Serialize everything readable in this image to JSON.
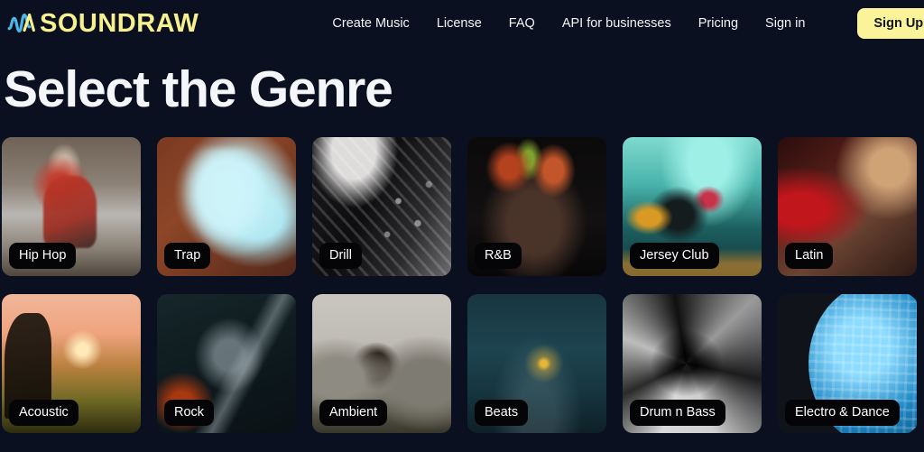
{
  "header": {
    "brand": {
      "wordmark": "SOUNDRAW",
      "logo_icon": "waveform-icon",
      "logo_color": "#4db8e8",
      "wordmark_color": "#f6f08f"
    },
    "nav_links": [
      {
        "label": "Create Music",
        "name": "nav-create-music"
      },
      {
        "label": "License",
        "name": "nav-license"
      },
      {
        "label": "FAQ",
        "name": "nav-faq"
      },
      {
        "label": "API for businesses",
        "name": "nav-api-for-businesses"
      },
      {
        "label": "Pricing",
        "name": "nav-pricing"
      },
      {
        "label": "Sign in",
        "name": "nav-sign-in"
      }
    ],
    "signup_label": "Sign Up",
    "signup_bg": "#faf39a",
    "signup_text_color": "#111722"
  },
  "page": {
    "title": "Select the Genre",
    "background": "#0a1020",
    "title_color": "#f4f6fa"
  },
  "genres": [
    {
      "label": "Hip Hop",
      "art": "art-hiphop",
      "name": "genre-card-hip-hop"
    },
    {
      "label": "Trap",
      "art": "art-trap",
      "name": "genre-card-trap"
    },
    {
      "label": "Drill",
      "art": "art-drill",
      "name": "genre-card-drill"
    },
    {
      "label": "R&B",
      "art": "art-rnb",
      "name": "genre-card-rnb"
    },
    {
      "label": "Jersey Club",
      "art": "art-jersey",
      "name": "genre-card-jersey-club"
    },
    {
      "label": "Latin",
      "art": "art-latin",
      "name": "genre-card-latin"
    },
    {
      "label": "Acoustic",
      "art": "art-acoustic",
      "name": "genre-card-acoustic"
    },
    {
      "label": "Rock",
      "art": "art-rock",
      "name": "genre-card-rock"
    },
    {
      "label": "Ambient",
      "art": "art-ambient",
      "name": "genre-card-ambient"
    },
    {
      "label": "Beats",
      "art": "art-beats",
      "name": "genre-card-beats"
    },
    {
      "label": "Drum n Bass",
      "art": "art-dnb",
      "name": "genre-card-drum-n-bass"
    },
    {
      "label": "Electro & Dance",
      "art": "art-electro",
      "name": "genre-card-electro-dance"
    }
  ]
}
